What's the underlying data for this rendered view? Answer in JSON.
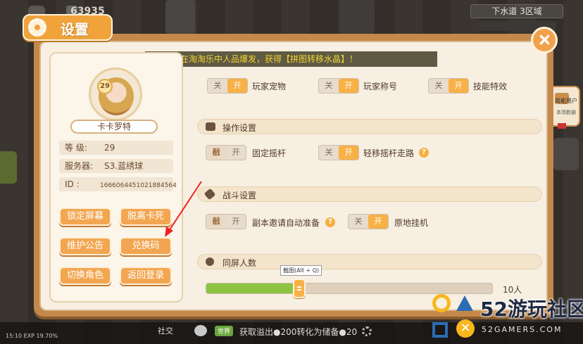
{
  "game": {
    "score": "63935",
    "zone": "下水道 3区域"
  },
  "dialog": {
    "title": "设置",
    "close_label": "✕",
    "notice": "星盖利】在淘淘乐中人品爆发，获得【拼图转移水晶】！"
  },
  "profile": {
    "level_badge": "29",
    "name": "卡卡罗特",
    "level_key": "等  级:",
    "level_value": "29",
    "server_key": "服务器:",
    "server_value": "S3.蓝绣球",
    "id_key": "ID  :",
    "id_value": "1666064451021884564"
  },
  "buttons": {
    "lock_screen": "锁定屏幕",
    "unstuck": "脱离卡死",
    "maintenance": "维护公告",
    "redeem": "兑换码",
    "switch_role": "切换角色",
    "back_login": "返回登录"
  },
  "toggles": {
    "off": "关",
    "on": "开",
    "lock_glyph": "㦼"
  },
  "display": {
    "pet": "玩家宠物",
    "title": "玩家称号",
    "skill": "技能特效"
  },
  "control": {
    "section": "操作设置",
    "fixed_joystick": "固定摇杆",
    "light_move": "轻移摇杆走路"
  },
  "battle": {
    "section": "战斗设置",
    "auto_ready": "副本邀请自动准备",
    "auto_idle": "原地挂机"
  },
  "screen_count": {
    "section": "同屏人数",
    "tooltip": "截图(Alt + Q)",
    "value": 0.3,
    "label": "10人"
  },
  "bottom": {
    "social": "社交",
    "badge": "世界",
    "message": "获取溢出●200转化为储备●20",
    "time": "15:10",
    "exp": "EXP 19.70%"
  },
  "side": {
    "user": "简能用户",
    "stats": "本场数据"
  },
  "watermark": {
    "main": "52游玩社区",
    "sub": "52GAMERS.COM"
  }
}
